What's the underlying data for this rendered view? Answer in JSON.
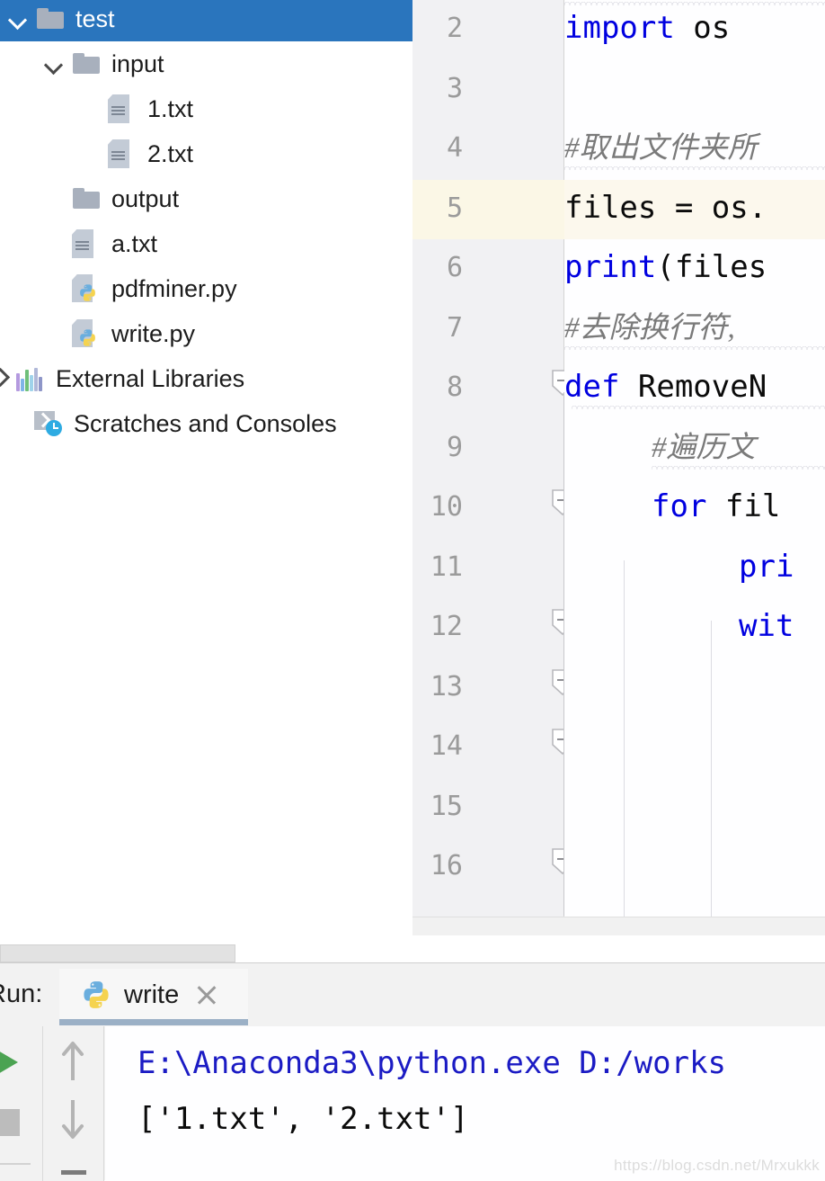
{
  "project_tree": {
    "name": "project-tree",
    "selected_index": 0,
    "items": [
      {
        "label": "test",
        "icon": "folder-icon",
        "chevron": "down",
        "indent": 0,
        "selected": true
      },
      {
        "label": "input",
        "icon": "folder-icon",
        "chevron": "down",
        "indent": 1,
        "selected": false
      },
      {
        "label": "1.txt",
        "icon": "text-file-icon",
        "chevron": "none",
        "indent": 2,
        "selected": false
      },
      {
        "label": "2.txt",
        "icon": "text-file-icon",
        "chevron": "none",
        "indent": 2,
        "selected": false
      },
      {
        "label": "output",
        "icon": "folder-icon",
        "chevron": "none",
        "indent": 1,
        "selected": false
      },
      {
        "label": "a.txt",
        "icon": "text-file-icon",
        "chevron": "none",
        "indent": 1,
        "selected": false
      },
      {
        "label": "pdfminer.py",
        "icon": "python-file-icon",
        "chevron": "none",
        "indent": 1,
        "selected": false
      },
      {
        "label": "write.py",
        "icon": "python-file-icon",
        "chevron": "none",
        "indent": 1,
        "selected": false
      },
      {
        "label": "External Libraries",
        "icon": "external-libraries-icon",
        "chevron": "right",
        "indent": 0,
        "selected": false
      },
      {
        "label": "Scratches and Consoles",
        "icon": "scratches-icon",
        "chevron": "none",
        "indent": 0,
        "selected": false
      }
    ]
  },
  "editor": {
    "highlighted_line": 5,
    "lines": [
      {
        "number": "2",
        "segments": [
          {
            "t": "import",
            "c": "kw"
          },
          {
            "t": " os",
            "c": "pl"
          }
        ],
        "indent": 0,
        "fold": false
      },
      {
        "number": "3",
        "segments": [],
        "indent": 0,
        "fold": false
      },
      {
        "number": "4",
        "segments": [
          {
            "t": "#取出文件夹所",
            "c": "cmt"
          }
        ],
        "indent": 0,
        "fold": false
      },
      {
        "number": "5",
        "segments": [
          {
            "t": "files = os.",
            "c": "pl"
          }
        ],
        "indent": 0,
        "fold": false
      },
      {
        "number": "6",
        "segments": [
          {
            "t": "print",
            "c": "kw"
          },
          {
            "t": "(files",
            "c": "pl"
          }
        ],
        "indent": 0,
        "fold": false
      },
      {
        "number": "7",
        "segments": [
          {
            "t": "#去除换行符,",
            "c": "cmt"
          }
        ],
        "indent": 0,
        "fold": false
      },
      {
        "number": "8",
        "segments": [
          {
            "t": "def",
            "c": "kw"
          },
          {
            "t": " RemoveN",
            "c": "pl"
          }
        ],
        "indent": 0,
        "fold": true
      },
      {
        "number": "9",
        "segments": [
          {
            "t": "#遍历文",
            "c": "cmt"
          }
        ],
        "indent": 1,
        "fold": false
      },
      {
        "number": "10",
        "segments": [
          {
            "t": "for",
            "c": "kw"
          },
          {
            "t": " fil",
            "c": "pl"
          }
        ],
        "indent": 1,
        "fold": true
      },
      {
        "number": "11",
        "segments": [
          {
            "t": "pri",
            "c": "kw"
          }
        ],
        "indent": 2,
        "fold": false
      },
      {
        "number": "12",
        "segments": [
          {
            "t": "wit",
            "c": "kw"
          }
        ],
        "indent": 2,
        "fold": true
      },
      {
        "number": "13",
        "segments": [],
        "indent": 0,
        "fold": true
      },
      {
        "number": "14",
        "segments": [],
        "indent": 0,
        "fold": true
      },
      {
        "number": "15",
        "segments": [],
        "indent": 0,
        "fold": false
      },
      {
        "number": "16",
        "segments": [],
        "indent": 0,
        "fold": true
      }
    ]
  },
  "run_panel": {
    "title": "Run:",
    "tab_name": "write",
    "tab_icon": "python-icon",
    "close_icon": "close-icon",
    "buttons": {
      "run": "run-icon",
      "stop": "stop-icon",
      "up": "arrow-up-icon",
      "down": "arrow-down-icon",
      "soft_wrap": "soft-wrap-icon"
    },
    "console": [
      {
        "text": "E:\\Anaconda3\\python.exe D:/works",
        "color": "c-blue"
      },
      {
        "text": "['1.txt', '2.txt']",
        "color": "c-black"
      }
    ]
  },
  "watermark": "https://blog.csdn.net/Mrxukkk",
  "colors": {
    "selection_blue": "#2a75bd",
    "keyword_blue": "#0000e0",
    "comment_grey": "#7a7a7a",
    "line_highlight": "#fcf8ed",
    "console_blue": "#1b1bc4",
    "run_green": "#4ba352",
    "tab_underline": "#9bb0c6"
  }
}
